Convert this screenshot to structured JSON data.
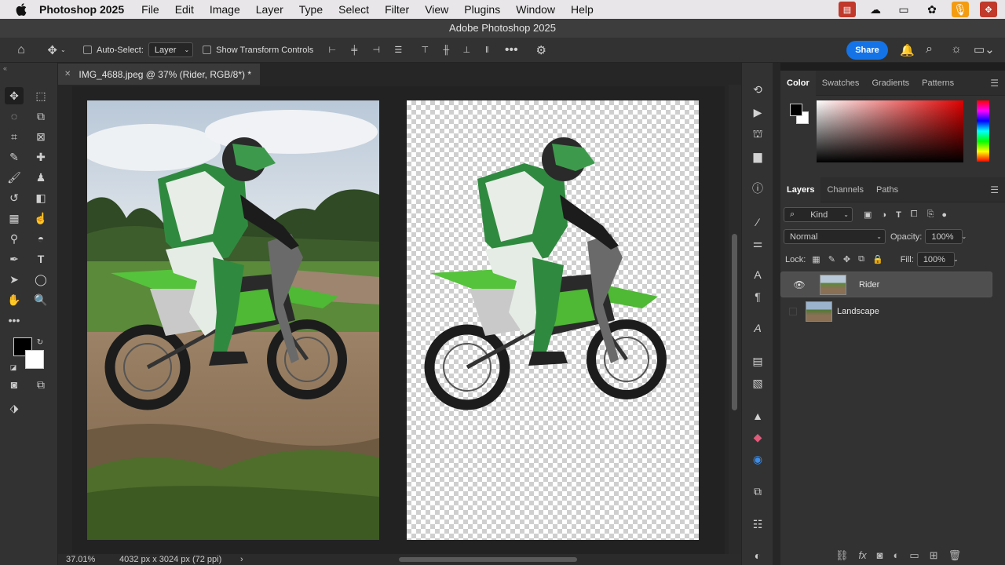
{
  "mac_menu": {
    "app": "Photoshop 2025",
    "items": [
      "File",
      "Edit",
      "Image",
      "Layer",
      "Type",
      "Select",
      "Filter",
      "View",
      "Plugins",
      "Window",
      "Help"
    ]
  },
  "window_title": "Adobe Photoshop 2025",
  "options_bar": {
    "auto_select_label": "Auto-Select:",
    "auto_select_value": "Layer",
    "show_transform_label": "Show Transform Controls",
    "share_label": "Share"
  },
  "document_tab": "IMG_4688.jpeg @ 37% (Rider, RGB/8*) *",
  "status_bar": {
    "zoom": "37.01%",
    "doc_info": "4032 px x 3024 px (72 ppi)",
    "arrow": "›"
  },
  "color_panel": {
    "tabs": [
      "Color",
      "Swatches",
      "Gradients",
      "Patterns"
    ],
    "active_tab": "Color",
    "foreground": "#000000",
    "background": "#ffffff"
  },
  "layers_panel": {
    "tabs": [
      "Layers",
      "Channels",
      "Paths"
    ],
    "active_tab": "Layers",
    "kind_label": "Kind",
    "blend_mode": "Normal",
    "opacity_label": "Opacity:",
    "opacity_value": "100%",
    "lock_label": "Lock:",
    "fill_label": "Fill:",
    "fill_value": "100%",
    "layers": [
      {
        "name": "Rider",
        "visible": true,
        "selected": true
      },
      {
        "name": "Landscape",
        "visible": false,
        "selected": false
      }
    ]
  },
  "colors": {
    "accent": "#1473e6"
  }
}
